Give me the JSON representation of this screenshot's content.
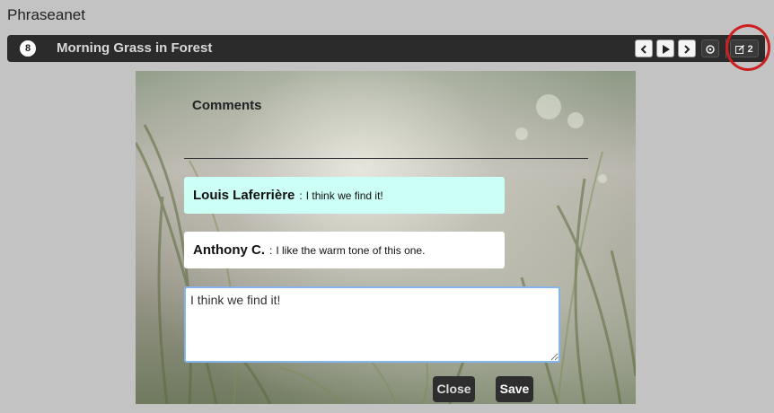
{
  "app": {
    "title": "Phraseanet"
  },
  "toolbar": {
    "count_badge": "8",
    "title": "Morning Grass in Forest",
    "edit_count": "2",
    "buttons": {
      "prev_icon": "chevron-left-icon",
      "play_icon": "play-icon",
      "next_icon": "chevron-right-icon",
      "info_icon": "info-circle-icon",
      "edit_icon": "edit-icon"
    }
  },
  "comments": {
    "title": "Comments",
    "items": [
      {
        "author": "Louis Laferrière",
        "separator": ":",
        "text": "I think we find it!",
        "background": "#ccfff5"
      },
      {
        "author": "Anthony C.",
        "separator": ":",
        "text": "I like the warm tone of this one.",
        "background": "#ffffff"
      }
    ],
    "input_value": "I think we find it!",
    "close_label": "Close",
    "save_label": "Save"
  },
  "colors": {
    "page_background": "#c3c3c3",
    "toolbar_background": "#2b2b2b",
    "highlight_circle": "#cc1f1f",
    "input_focus_border": "#82b6e8"
  }
}
